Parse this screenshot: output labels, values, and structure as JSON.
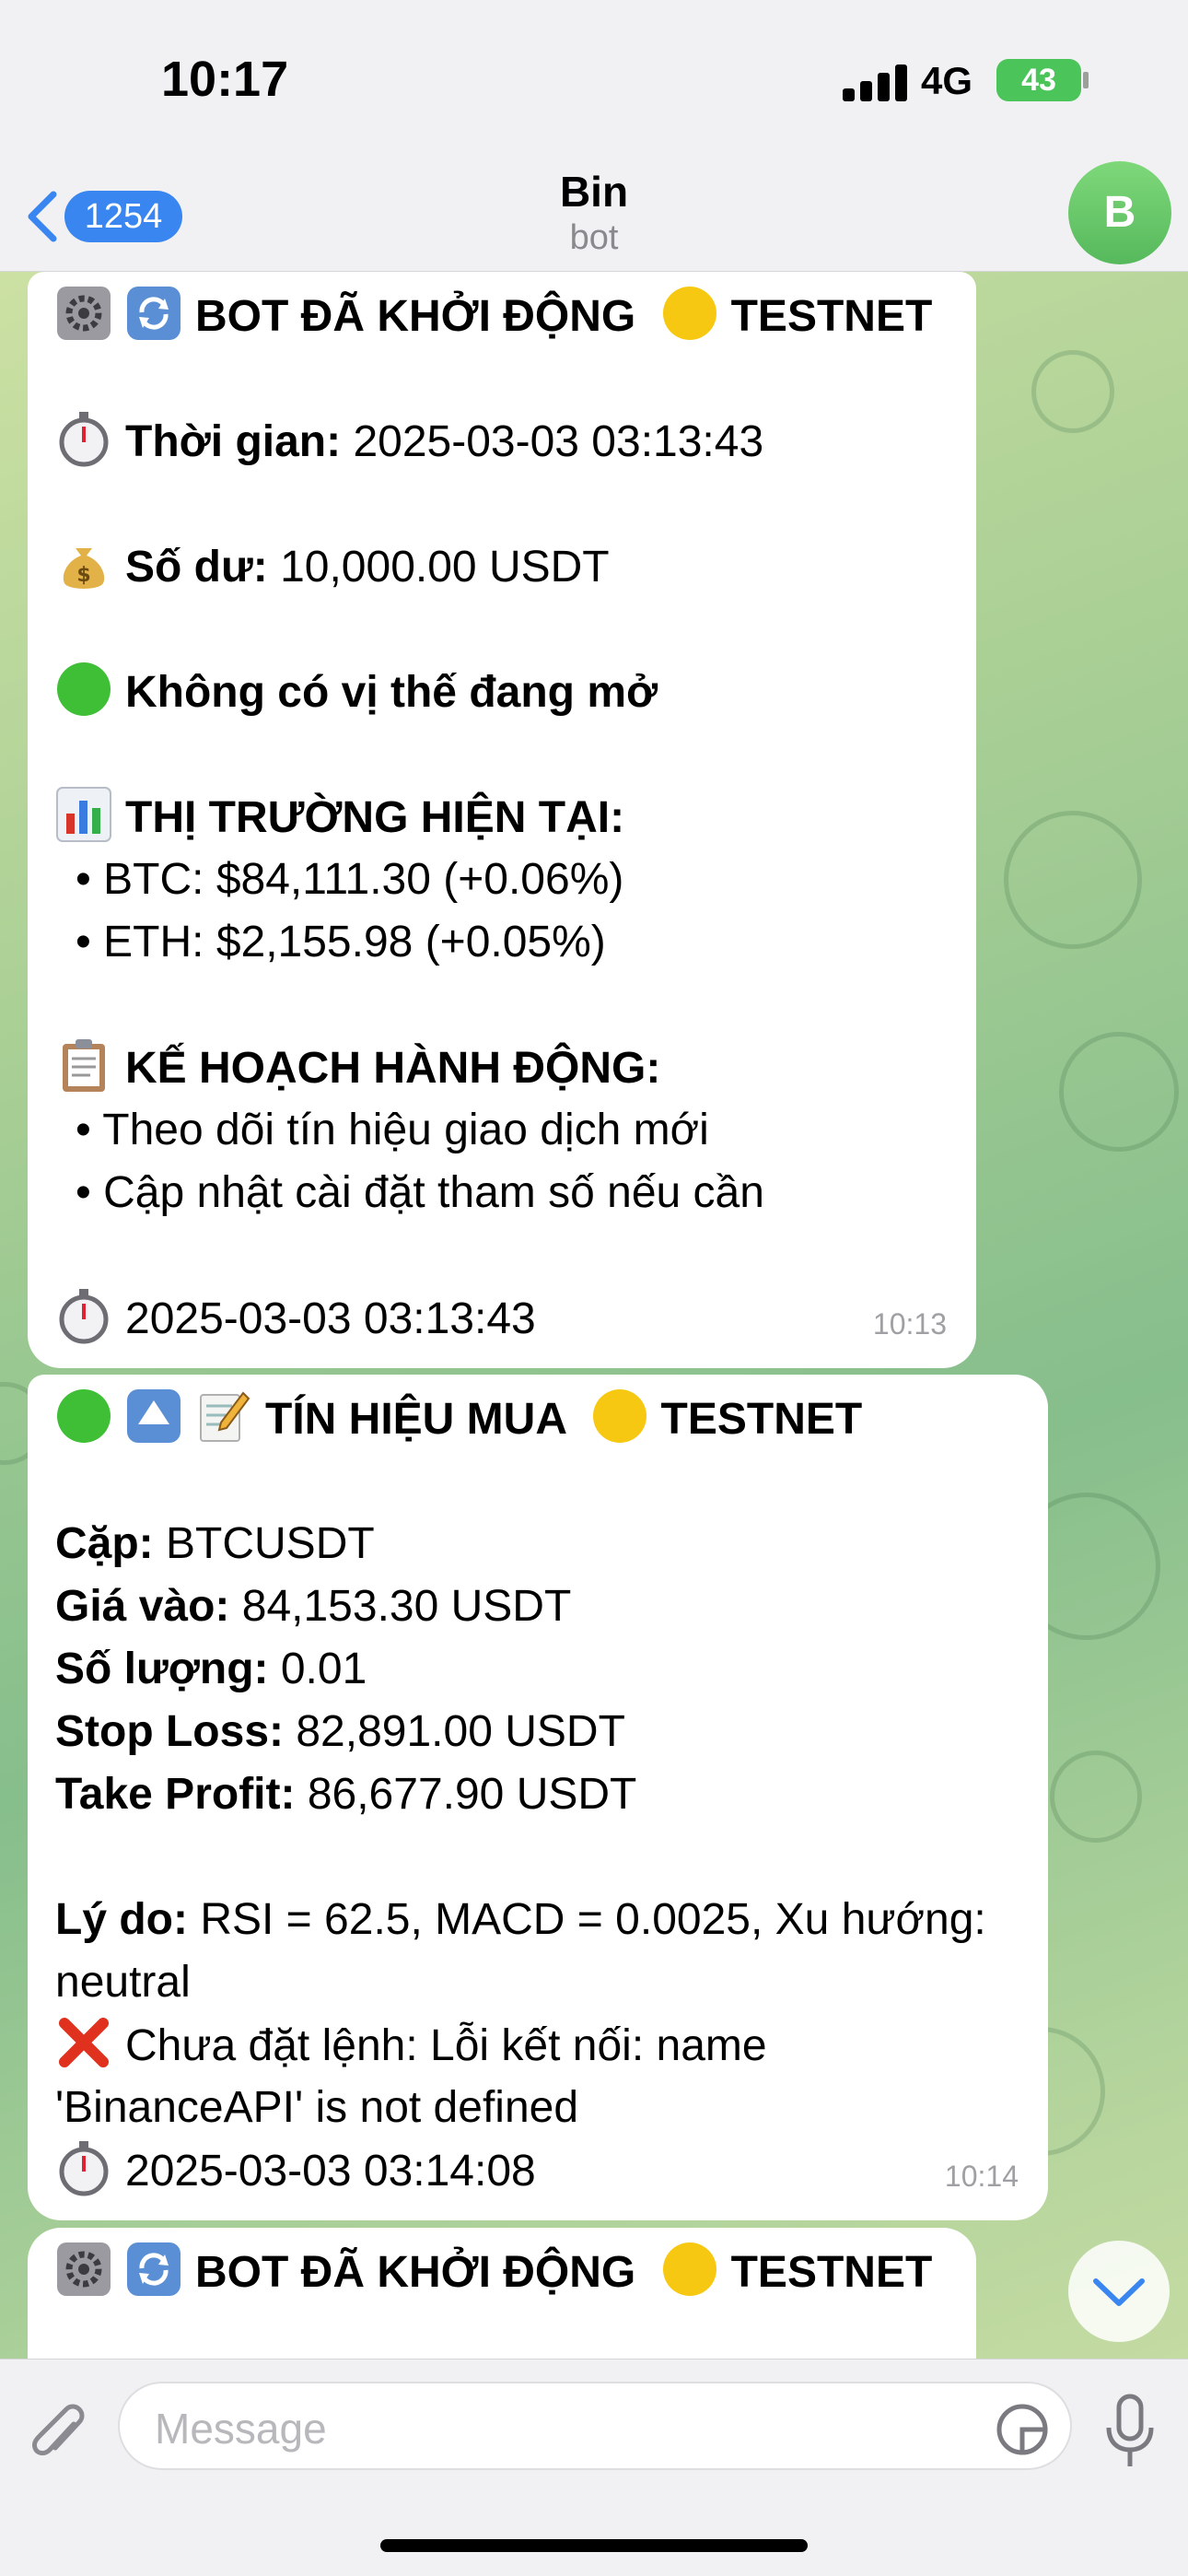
{
  "status_bar": {
    "time": "10:17",
    "network": "4G",
    "battery": "43"
  },
  "header": {
    "back_badge": "1254",
    "title": "Bin",
    "subtitle": "bot",
    "avatar_letter": "B"
  },
  "messages": [
    {
      "title": "BOT ĐÃ KHỞI ĐỘNG",
      "tag": "TESTNET",
      "time_label": "Thời gian:",
      "time_value": "2025-03-03 03:13:43",
      "balance_label": "Số dư:",
      "balance_value": "10,000.00 USDT",
      "position_status": "Không có vị thế đang mở",
      "market_heading": "THỊ TRƯỜNG HIỆN TẠI:",
      "market_items": [
        "• BTC: $84,111.30 (+0.06%)",
        "• ETH: $2,155.98 (+0.05%)"
      ],
      "plan_heading": "KẾ HOẠCH HÀNH ĐỘNG:",
      "plan_items": [
        "• Theo dõi tín hiệu giao dịch mới",
        "• Cập nhật cài đặt tham số nếu cần"
      ],
      "footer_time": "2025-03-03 03:13:43",
      "sent_at": "10:13"
    },
    {
      "title": "TÍN HIỆU MUA",
      "tag": "TESTNET",
      "pair_label": "Cặp:",
      "pair_value": "BTCUSDT",
      "entry_label": "Giá vào:",
      "entry_value": "84,153.30 USDT",
      "qty_label": "Số lượng:",
      "qty_value": "0.01",
      "sl_label": "Stop Loss:",
      "sl_value": "82,891.00 USDT",
      "tp_label": "Take Profit:",
      "tp_value": "86,677.90 USDT",
      "reason_label": "Lý do:",
      "reason_line1": "RSI = 62.5, MACD = 0.0025, Xu hướng:",
      "reason_line2": "neutral",
      "error_line1": "Chưa đặt lệnh: Lỗi kết nối: name",
      "error_line2": "'BinanceAPI' is not defined",
      "footer_time": "2025-03-03 03:14:08",
      "sent_at": "10:14"
    },
    {
      "title": "BOT ĐÃ KHỞI ĐỘNG",
      "tag": "TESTNET"
    }
  ],
  "input": {
    "placeholder": "Message"
  },
  "icons": {
    "gear": "gear-icon",
    "refresh": "refresh-icon",
    "yellow_circle": "yellow-circle-icon",
    "stopwatch": "stopwatch-icon",
    "money_bag": "money-bag-icon",
    "green_circle": "green-circle-icon",
    "bar_chart": "bar-chart-icon",
    "clipboard": "clipboard-icon",
    "up_arrow": "up-arrow-icon",
    "memo": "memo-icon",
    "cross": "cross-mark-icon"
  },
  "colors": {
    "accent": "#3a86f0",
    "battery": "#4bc45a",
    "avatar": "#5cbf61",
    "error": "#e0301e"
  }
}
